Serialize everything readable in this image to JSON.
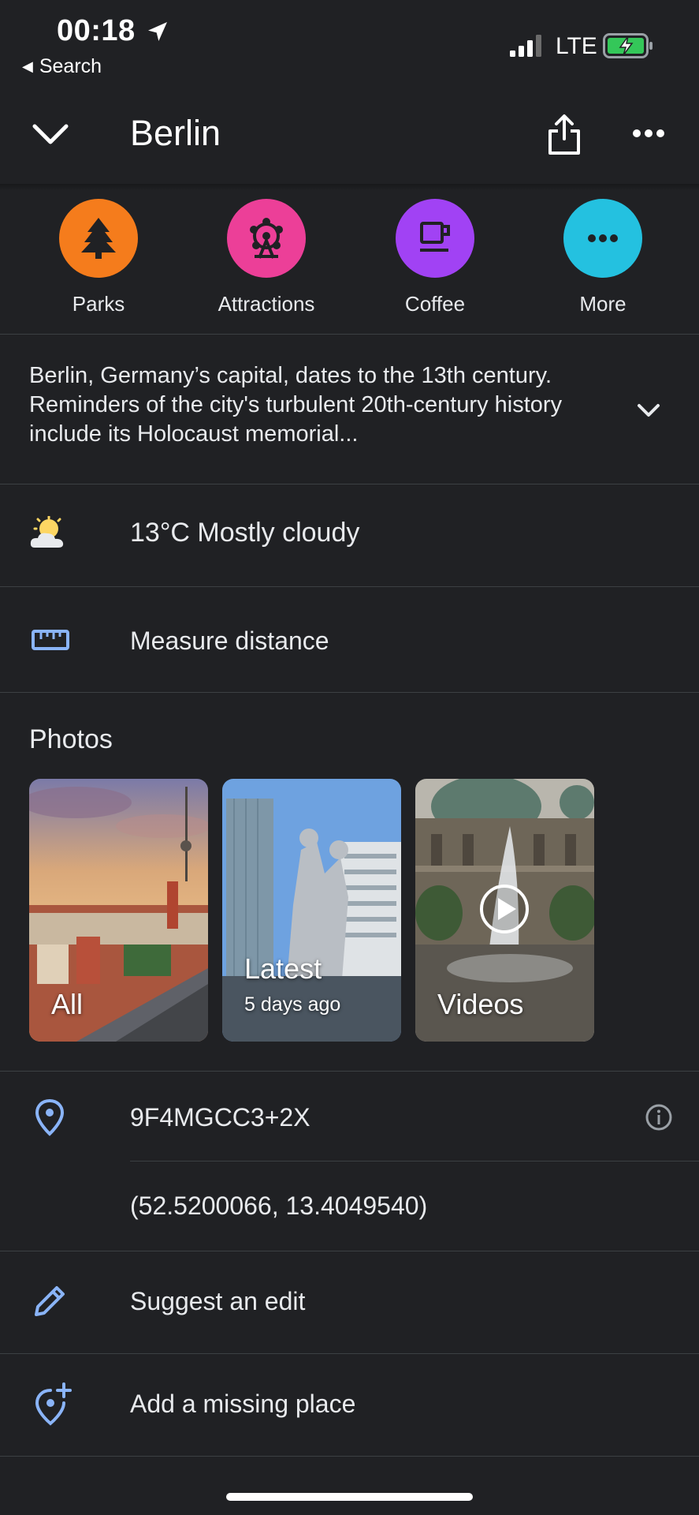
{
  "status_bar": {
    "time": "00:18",
    "back_label": "Search",
    "network": "LTE"
  },
  "header": {
    "title": "Berlin"
  },
  "categories": [
    {
      "label": "Parks",
      "color": "#f57c1c",
      "icon": "tree-icon"
    },
    {
      "label": "Attractions",
      "color": "#ec3f98",
      "icon": "ferris-wheel-icon"
    },
    {
      "label": "Coffee",
      "color": "#a142f4",
      "icon": "coffee-cup-icon"
    },
    {
      "label": "More",
      "color": "#24c1e0",
      "icon": "more-dots-icon"
    }
  ],
  "description": "Berlin, Germany’s capital, dates to the 13th century. Reminders of the city's turbulent 20th-century history include its Holocaust memorial...",
  "weather": {
    "text": "13°C Mostly cloudy",
    "icon": "partly-cloudy-icon"
  },
  "measure": {
    "label": "Measure distance",
    "icon": "ruler-icon"
  },
  "photos": {
    "title": "Photos",
    "items": [
      {
        "label": "All",
        "sub": ""
      },
      {
        "label": "Latest",
        "sub": "5 days ago"
      },
      {
        "label": "Videos",
        "sub": ""
      }
    ]
  },
  "location": {
    "plus_code": "9F4MGCC3+2X",
    "coordinates": "(52.5200066, 13.4049540)"
  },
  "actions": {
    "suggest_edit": "Suggest an edit",
    "add_place": "Add a missing place"
  },
  "colors": {
    "background": "#202124",
    "accent_blue": "#8ab4f8"
  }
}
